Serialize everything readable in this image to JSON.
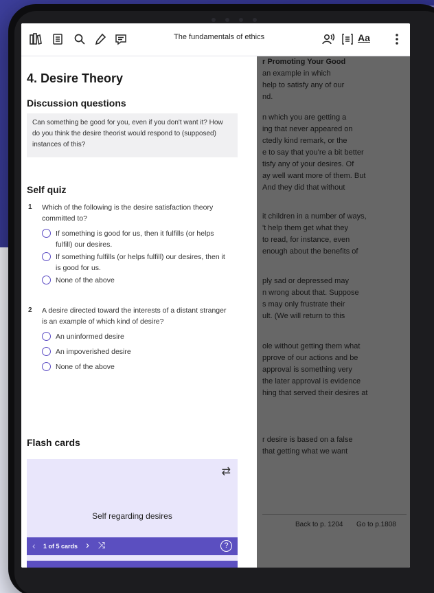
{
  "toolbar": {
    "book_title": "The fundamentals of ethics",
    "font_button_label": "Aa",
    "icons": [
      "library-icon",
      "contents-icon",
      "search-icon",
      "highlight-icon",
      "notes-icon",
      "listen-icon",
      "reader-view-icon",
      "more-icon"
    ]
  },
  "panel": {
    "chapter_title": "4. Desire Theory",
    "discussion": {
      "heading": "Discussion questions",
      "text": "Can something be good for you, even if you don't want it? How do you think the desire theorist would respond to (supposed) instances of this?"
    },
    "quiz": {
      "heading": "Self quiz",
      "questions": [
        {
          "number": "1",
          "text": "Which of the following is the desire satisfaction theory committed to?",
          "options": [
            "If something is good for us, then it fulfills (or helps fulfill) our desires.",
            "If something fulfills (or helps fulfill) our desires, then it is good for us.",
            "None of the above"
          ]
        },
        {
          "number": "2",
          "text": "A desire directed toward the interests of a distant stranger is an example of which kind of desire?",
          "options": [
            "An uninformed desire",
            "An impoverished desire",
            "None of the above"
          ]
        }
      ]
    },
    "flashcards": {
      "heading": "Flash cards",
      "card_text": "Self regarding desires",
      "counter": "1 of 5 cards"
    }
  },
  "right_page": {
    "lines": [
      "r Promoting Your Good",
      "an example in which",
      "help to satisfy any of our",
      "nd.",
      "n which you are getting a",
      "ing that never appeared on",
      "ctedly kind remark, or the",
      "e to say that you're a bit better",
      "tisfy any of your desires. Of",
      "ay well want more of them. But",
      "And they did that without",
      "it children in a number of ways,",
      "'t help them get what they",
      "to read, for instance, even",
      "enough about the benefits of",
      "ply sad or depressed may",
      "n wrong about that. Suppose",
      "s may only frustrate their",
      "ult. (We will return to this",
      "ole without getting them what",
      "pprove of our actions and be",
      "approval is something very",
      "the later approval is evidence",
      "hing that served their desires at",
      "r desire is based on a false",
      "that getting what we want"
    ],
    "back_link": "Back to p. 1204",
    "goto_link": "Go to p.1808"
  }
}
